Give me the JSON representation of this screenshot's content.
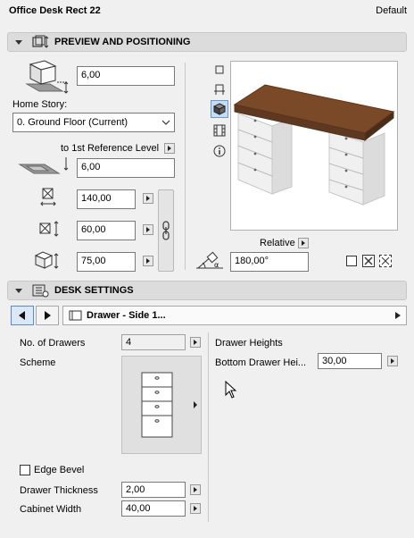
{
  "header": {
    "title": "Office Desk Rect 22",
    "default_label": "Default"
  },
  "preview": {
    "section_title": "PREVIEW AND POSITIONING",
    "elevation_value": "6,00",
    "home_story_label": "Home Story:",
    "home_story_value": "0. Ground Floor (Current)",
    "ref_level_label": "to 1st Reference Level",
    "ref_level_value": "6,00",
    "width_value": "140,00",
    "depth_value": "60,00",
    "height_value": "75,00",
    "relative_label": "Relative",
    "rotation_value": "180,00°"
  },
  "desk": {
    "section_title": "DESK SETTINGS",
    "nav_page": "Drawer - Side 1...",
    "no_drawers_label": "No. of Drawers",
    "no_drawers_value": "4",
    "scheme_label": "Scheme",
    "drawer_heights_label": "Drawer Heights",
    "bottom_drawer_label": "Bottom Drawer Hei...",
    "bottom_drawer_value": "30,00",
    "edge_bevel_label": "Edge Bevel",
    "drawer_thickness_label": "Drawer Thickness",
    "drawer_thickness_value": "2,00",
    "cabinet_width_label": "Cabinet Width",
    "cabinet_width_value": "40,00"
  },
  "colors": {
    "desktop": "#7a4a28",
    "cabinet": "#f4f4f4",
    "accent": "#0066cc"
  }
}
